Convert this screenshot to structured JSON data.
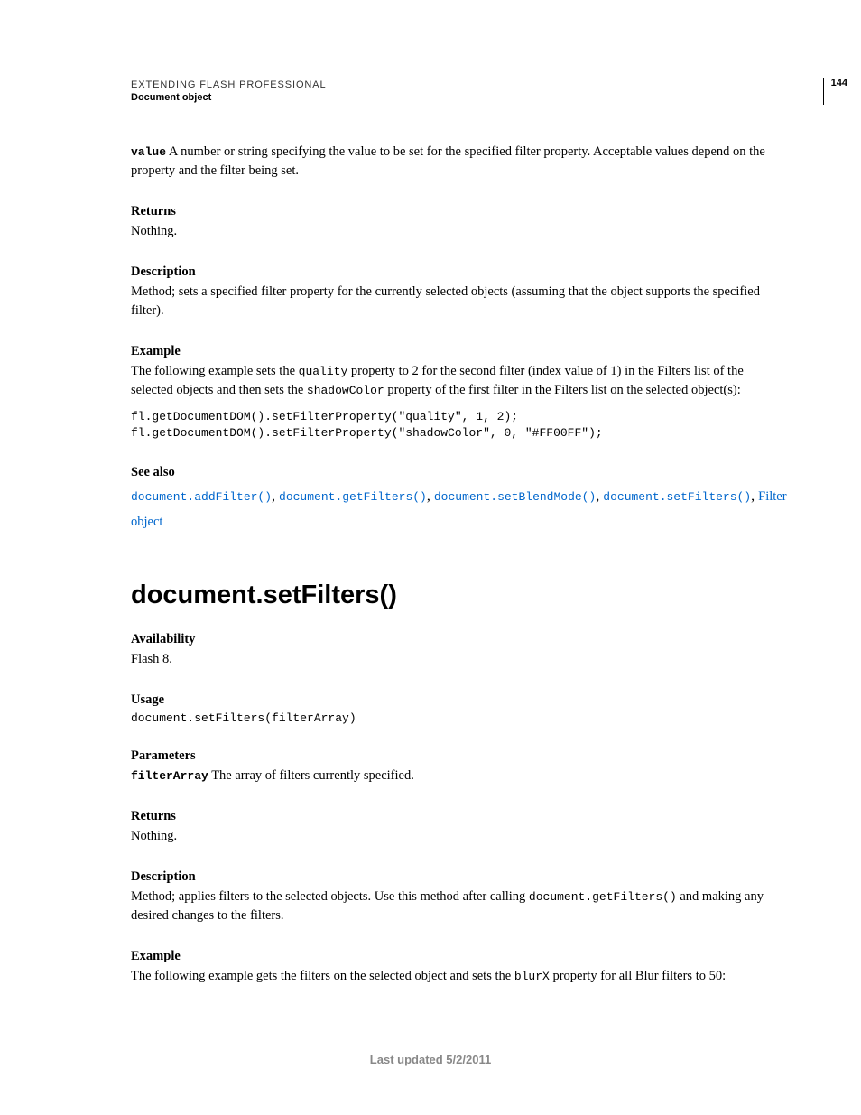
{
  "header": {
    "title": "EXTENDING FLASH PROFESSIONAL",
    "subtitle": "Document object",
    "page_number": "144"
  },
  "section1": {
    "value_param": "value",
    "value_desc": "  A number or string specifying the value to be set for the specified filter property. Acceptable values depend on the property and the filter being set.",
    "returns_label": "Returns",
    "returns_text": "Nothing.",
    "description_label": "Description",
    "description_text": "Method; sets a specified filter property for the currently selected objects (assuming that the object supports the specified filter).",
    "example_label": "Example",
    "example_intro_a": "The following example sets the ",
    "example_quality": "quality",
    "example_intro_b": " property to 2 for the second filter (index value of 1) in the Filters list of the selected objects and then sets the ",
    "example_shadow": "shadowColor",
    "example_intro_c": " property of the first filter in the Filters list on the selected object(s):",
    "code": "fl.getDocumentDOM().setFilterProperty(\"quality\", 1, 2);\nfl.getDocumentDOM().setFilterProperty(\"shadowColor\", 0, \"#FF00FF\");",
    "seealso_label": "See also",
    "links": {
      "l1": "document.addFilter()",
      "l2": "document.getFilters()",
      "l3": "document.setBlendMode()",
      "l4": "document.setFilters()",
      "l5": "Filter object"
    }
  },
  "section2": {
    "title": "document.setFilters()",
    "availability_label": "Availability",
    "availability_text": "Flash 8.",
    "usage_label": "Usage",
    "usage_code": "document.setFilters(filterArray)",
    "parameters_label": "Parameters",
    "param_name": "filterArray",
    "param_desc": "  The array of filters currently specified.",
    "returns_label": "Returns",
    "returns_text": "Nothing.",
    "description_label": "Description",
    "description_a": "Method; applies filters to the selected objects. Use this method after calling ",
    "description_code": "document.getFilters()",
    "description_b": " and making any desired changes to the filters.",
    "example_label": "Example",
    "example_a": "The following example gets the filters on the selected object and sets the ",
    "example_code": "blurX",
    "example_b": " property for all Blur filters to 50:"
  },
  "footer": "Last updated 5/2/2011"
}
